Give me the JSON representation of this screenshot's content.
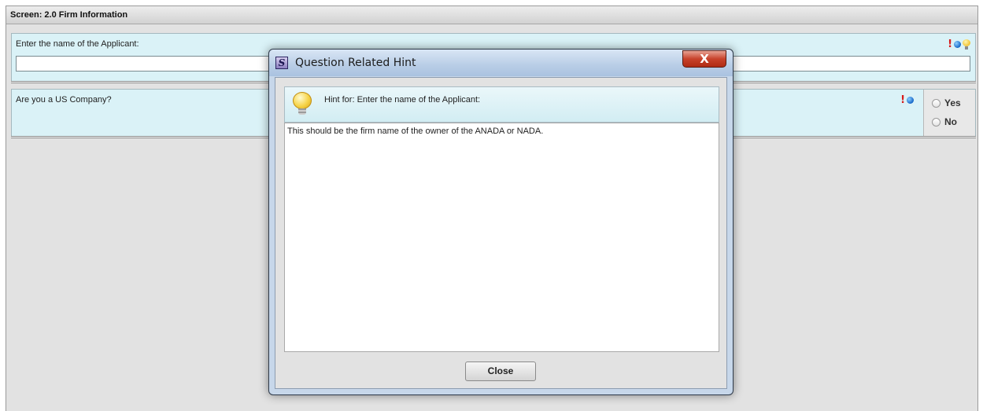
{
  "screen": {
    "header": "Screen: 2.0 Firm Information"
  },
  "questions": [
    {
      "text": "Enter the name of the Applicant:",
      "input_value": "",
      "icons": [
        "required-icon",
        "info-dot-icon",
        "hint-bulb-icon"
      ]
    },
    {
      "text": "Are you a US Company?",
      "icons": [
        "required-icon",
        "info-dot-icon"
      ],
      "options": [
        {
          "label": "Yes",
          "selected": false
        },
        {
          "label": "No",
          "selected": false
        }
      ]
    }
  ],
  "dialog": {
    "title": "Question Related Hint",
    "app_icon_letter": "S",
    "close_glyph": "X",
    "hint_title": "Hint for: Enter the name of the Applicant:",
    "hint_body": "This should be the firm name of the owner of the ANADA or NADA.",
    "close_button": "Close"
  },
  "colors": {
    "question_bg": "#daf2f7",
    "required": "#d81b1b",
    "info_dot": "#1566c8",
    "hint_bulb": "#f1c232",
    "dialog_frame": "#c7d7ea"
  }
}
